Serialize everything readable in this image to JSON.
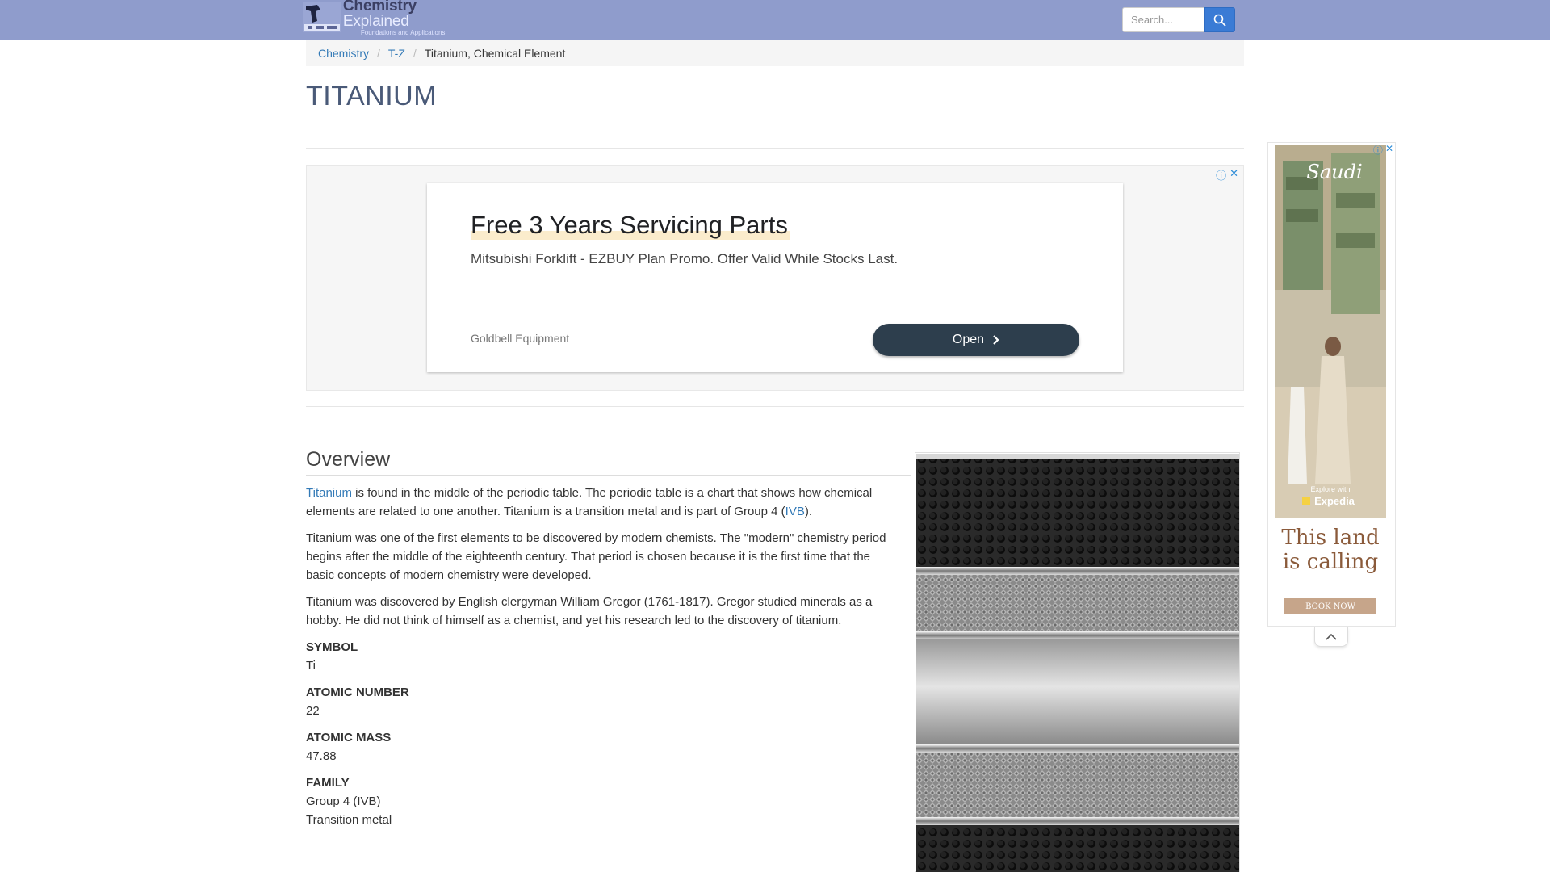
{
  "header": {
    "logo_title_bold": "Chemistry",
    "logo_title_light": "Explained",
    "logo_sub": "Foundations and Applications",
    "search_placeholder": "Search..."
  },
  "breadcrumb": [
    {
      "label": "Chemistry"
    },
    {
      "label": "T-Z"
    },
    {
      "label": "Titanium, Chemical Element"
    }
  ],
  "page_title": "TITANIUM",
  "ad": {
    "headline": "Free 3 Years Servicing Parts",
    "description": "Mitsubishi Forklift - EZBUY Plan Promo. Offer Valid While Stocks Last.",
    "advertiser": "Goldbell Equipment",
    "cta": "Open"
  },
  "article": {
    "section_heading": "Overview",
    "p1_link": "Titanium",
    "p1_text": " is found in the middle of the periodic table. The periodic table is a chart that shows how chemical elements are related to one another. Titanium is a transition metal and is part of Group 4 (",
    "p1_link2": "IVB",
    "p1_end": ").",
    "p2": "Titanium was one of the first elements to be discovered by modern chemists. The \"modern\" chemistry period begins after the middle of the eighteenth century. That period is chosen because it is the first time that the basic concepts of modern chemistry were developed.",
    "p3": "Titanium was discovered by English clergyman William Gregor (1761-1817). Gregor studied minerals as a hobby. He did not think of himself as a chemist, and yet his research led to the discovery of titanium.",
    "facts": [
      {
        "label": "SYMBOL",
        "values": [
          "Ti"
        ]
      },
      {
        "label": "ATOMIC NUMBER",
        "values": [
          "22"
        ]
      },
      {
        "label": "ATOMIC MASS",
        "values": [
          "47.88"
        ]
      },
      {
        "label": "FAMILY",
        "values": [
          "Group 4 (IVB)",
          "Transition metal"
        ]
      }
    ]
  },
  "side_ad": {
    "brand": "Saudi",
    "partner": "Expedia",
    "partner_pre": "Explore with",
    "tagline_1": "This land",
    "tagline_2": "is calling",
    "cta": "BOOK NOW"
  },
  "colors": {
    "header_bg": "#8f9ccc",
    "link": "#337ab7",
    "search_btn": "#3a7bd5",
    "ad_cta_bg": "#2d3e4d"
  },
  "icons": {
    "search": "search-icon",
    "ad_info": "info-icon",
    "ad_close": "close-icon",
    "chevron": "chevron-right-icon",
    "collapse": "chevron-up-icon"
  }
}
